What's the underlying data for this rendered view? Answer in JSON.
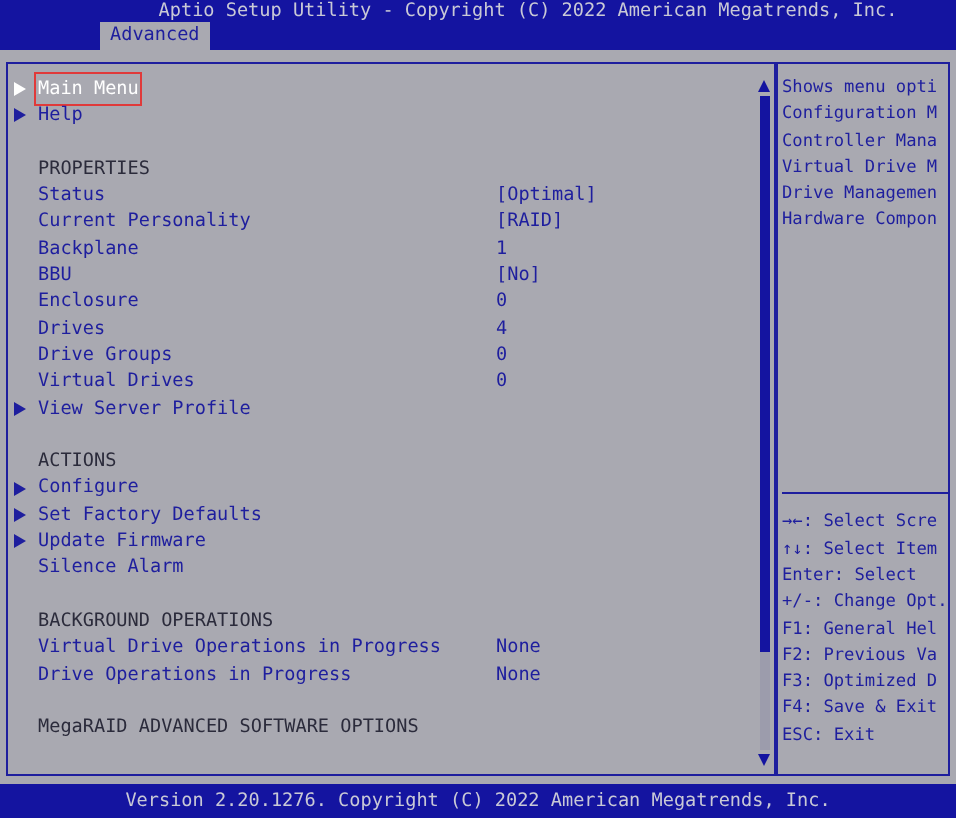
{
  "title": "Aptio Setup Utility - Copyright (C) 2022 American Megatrends, Inc.",
  "tabs": [
    {
      "label": "Advanced",
      "selected": true
    }
  ],
  "menu": [
    {
      "kind": "submenu",
      "label": "Main Menu",
      "selected": true
    },
    {
      "kind": "submenu",
      "label": "Help",
      "selected": false
    },
    {
      "kind": "heading",
      "label": "PROPERTIES",
      "selected": false
    },
    {
      "kind": "property",
      "label": "Status",
      "value": "[Optimal]",
      "selected": false
    },
    {
      "kind": "property",
      "label": "Current Personality",
      "value": "[RAID]",
      "selected": false
    },
    {
      "kind": "property",
      "label": "Backplane",
      "value": "1",
      "selected": false
    },
    {
      "kind": "property",
      "label": "BBU",
      "value": "[No]",
      "selected": false
    },
    {
      "kind": "property",
      "label": "Enclosure",
      "value": "0",
      "selected": false
    },
    {
      "kind": "property",
      "label": "Drives",
      "value": "4",
      "selected": false
    },
    {
      "kind": "property",
      "label": "Drive Groups",
      "value": "0",
      "selected": false
    },
    {
      "kind": "property",
      "label": "Virtual Drives",
      "value": "0",
      "selected": false
    },
    {
      "kind": "submenu",
      "label": "View Server Profile",
      "selected": false
    },
    {
      "kind": "heading",
      "label": "ACTIONS",
      "selected": false
    },
    {
      "kind": "submenu",
      "label": "Configure",
      "selected": false
    },
    {
      "kind": "submenu",
      "label": "Set Factory Defaults",
      "selected": false
    },
    {
      "kind": "submenu",
      "label": "Update Firmware",
      "selected": false
    },
    {
      "kind": "action",
      "label": "Silence Alarm",
      "selected": false
    },
    {
      "kind": "heading",
      "label": "BACKGROUND OPERATIONS",
      "selected": false
    },
    {
      "kind": "property",
      "label": "Virtual Drive Operations in Progress",
      "value": "None",
      "selected": false
    },
    {
      "kind": "property",
      "label": "Drive Operations in Progress",
      "value": "None",
      "selected": false
    },
    {
      "kind": "heading",
      "label": "MegaRAID ADVANCED SOFTWARE OPTIONS",
      "selected": false
    }
  ],
  "help_text": [
    "Shows menu opti",
    "Configuration M",
    "Controller Mana",
    "Virtual Drive M",
    "Drive Managemen",
    "Hardware Compon"
  ],
  "key_help": [
    "→←: Select Scre",
    "↑↓: Select Item",
    "Enter: Select",
    "+/-: Change Opt.",
    "F1: General Hel",
    "F2: Previous Va",
    "F3: Optimized D",
    "F4: Save & Exit",
    "ESC: Exit"
  ],
  "footer": "Version 2.20.1276. Copyright (C) 2022 American Megatrends, Inc."
}
